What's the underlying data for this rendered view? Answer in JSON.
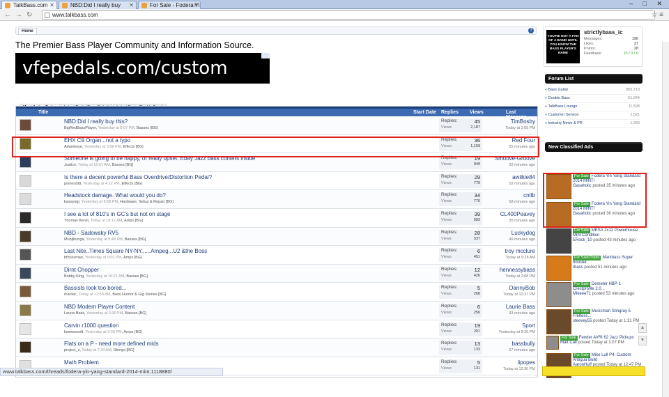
{
  "browser": {
    "tabs": [
      {
        "label": "TalkBass.com",
        "active": true
      },
      {
        "label": "NBD:Did I really buy",
        "active": false
      },
      {
        "label": "For Sale - Fodera Yin",
        "active": false
      }
    ],
    "window_controls": "– □ ✕",
    "url": "www.talkbass.com",
    "status_url": "www.talkbass.com/threads/fodera-yin-yang-standard-2014-mint.1118880/"
  },
  "page": {
    "breadcrumb_home": "Home",
    "help_icon": "?",
    "tagline": "The Premier Bass Player Community and Information Source.",
    "banner_text": "vfepedals.com/custom"
  },
  "list_tabs": [
    "Most Active Today",
    "Latest Posts (Bass Guitar)",
    "Latest Posts (Double Bass)"
  ],
  "table_headers": {
    "title": "Title",
    "start_date": "Start Date",
    "replies": "Replies",
    "views": "Views",
    "last_message": "Last Message"
  },
  "stat_labels": {
    "replies": "Replies:",
    "views": "Views:"
  },
  "threads": [
    {
      "title": "NBD:Did I really buy this?",
      "author": "BigRedBassPlayer",
      "date": "Yesterday at 8:07 PM",
      "forum": "Basses [BG]",
      "replies": "45",
      "views": "2,187",
      "last_user": "TimBosby",
      "last_time": "Today at 2:05 PM"
    },
    {
      "title": "EHX C9 Organ...not a typo",
      "author": "Adamkoye",
      "date": "Yesterday at 3:08 PM",
      "forum": "Effects [BG]",
      "replies": "36",
      "views": "1,159",
      "last_user": "Red Four",
      "last_time": "55 minutes ago"
    },
    {
      "title": "Someone is going to be happy, or really upset. Ebay Jazz bass content inside",
      "author": "Justice",
      "date": "Today at 10:51 AM",
      "forum": "Basses [BG]",
      "replies": "19",
      "views": "949",
      "last_user": "Smoove-Groove",
      "last_time": "32 minutes ago"
    },
    {
      "title": "Is there a decent powerful Bass Overdrive/Distortion Pedal?",
      "author": "jonners98",
      "date": "Yesterday at 4:12 PM",
      "forum": "Effects [BG]",
      "replies": "29",
      "views": "779",
      "last_user": "awilkie84",
      "last_time": "52 minutes ago"
    },
    {
      "title": "Headstock damage. What would you do?",
      "author": "bassyogi",
      "date": "Yesterday at 6:58 PM",
      "forum": "Hardware, Setup & Repair [BG]",
      "replies": "34",
      "views": "770",
      "last_user": "cnltb",
      "last_time": "58 minutes ago"
    },
    {
      "title": "I see a lot of 810's in GC's but not on stage",
      "author": "Thomas Kievit",
      "date": "Today at 10:12 AM",
      "forum": "Amps [BG]",
      "replies": "39",
      "views": "583",
      "last_user": "CL400Peavey",
      "last_time": "35 minutes ago"
    },
    {
      "title": "NBD - Sadowsky RV5",
      "author": "Munjibunga",
      "date": "Yesterday at 5:48 PM",
      "forum": "Basses [BG]",
      "replies": "28",
      "views": "537",
      "last_user": "Luckydog",
      "last_time": "49 minutes ago"
    },
    {
      "title": "Last Nite..Times Square NY-NY......Ampeg...U2 &the Boss",
      "author": "bfbossman",
      "date": "Yesterday at 9:03 PM",
      "forum": "Amps [BG]",
      "replies": "6",
      "views": "451",
      "last_user": "troy mcclure",
      "last_time": "Today at 9:28 AM"
    },
    {
      "title": "Dirnt Chopper",
      "author": "Bobby King",
      "date": "Yesterday at 10:21 AM",
      "forum": "Basses [BG]",
      "replies": "12",
      "views": "426",
      "last_user": "hennessybass",
      "last_time": "Today at 2:08 PM"
    },
    {
      "title": "Bassists look too bored...",
      "author": "mactac",
      "date": "Today at 12:58 AM",
      "forum": "Bass Humor & Gig Stories [BG]",
      "replies": "5",
      "views": "268",
      "last_user": "DannyBob",
      "last_time": "Today at 12:37 PM"
    },
    {
      "title": "NBD Modern Player Content",
      "author": "Laurie Bass",
      "date": "Yesterday at 3:30 PM",
      "forum": "Basses [BG]",
      "replies": "6",
      "views": "256",
      "last_user": "Laurie Bass",
      "last_time": "33 minutes ago"
    },
    {
      "title": "Carvin r1000 question",
      "author": "lowewesoft",
      "date": "Yesterday at 3:03 PM",
      "forum": "Amps [BG]",
      "replies": "19",
      "views": "201",
      "last_user": "5port",
      "last_time": "Yesterday at 8:25 PM"
    },
    {
      "title": "Flats on a P - need more defined mids",
      "author": "project_z",
      "date": "Today at 7:24 AM",
      "forum": "Strings [BG]",
      "replies": "13",
      "views": "133",
      "last_user": "bassbully",
      "last_time": "57 minutes ago"
    },
    {
      "title": "Math Problem",
      "author": "",
      "date": "",
      "forum": "",
      "replies": "5",
      "views": "131",
      "last_user": "iipopes",
      "last_time": "Today at 12:30 PM"
    }
  ],
  "profile": {
    "avatar_text": "YOU'RE NOT A FAN OF A BAND UNTIL YOU KNOW THE BASS PLAYER'S NAME",
    "username": "strictlybass_ic",
    "stats": [
      {
        "label": "Messages:",
        "value": "196"
      },
      {
        "label": "Likes:",
        "value": "37"
      },
      {
        "label": "Points:",
        "value": "28"
      },
      {
        "label": "Feedback:",
        "value": "15 / 0 / 0"
      }
    ]
  },
  "forum_list": {
    "heading": "Forum List",
    "items": [
      {
        "label": "Bass Guitar",
        "count": "865,710"
      },
      {
        "label": "Double Bass",
        "count": "51,844"
      },
      {
        "label": "TalkBass Lounge",
        "count": "11,598"
      },
      {
        "label": "Customer Service",
        "count": "2,521"
      },
      {
        "label": "Industry News & PR",
        "count": "1,293"
      }
    ]
  },
  "classifieds": {
    "heading": "New Classified Ads",
    "posted_word": "posted",
    "items": [
      {
        "badge": "For Sale",
        "title": "Fodera Yin Yang Standard 2014 MINT!",
        "user": "Gasaholic",
        "time": "35 minutes ago"
      },
      {
        "badge": "For Sale",
        "title": "Fodera Yin Yang Standard 2014 MINT!",
        "user": "Gasaholic",
        "time": "36 minutes ago"
      },
      {
        "badge": "For Sale",
        "title": "MESA 2x12 Powerhouse Mint Condition",
        "user": "ERock_10",
        "time": "43 minutes ago"
      },
      {
        "badge": "For Sale/Trade",
        "title": "Markbass Super booster",
        "user": "rbass",
        "time": "51 minutes ago"
      },
      {
        "badge": "For Sale",
        "title": "Demeter HBP-1 Crestprofile 2.0...",
        "user": "Mikeee71",
        "time": "53 minutes ago"
      },
      {
        "badge": "For Sale",
        "title": "Musicman Stingray 5 Fretless...",
        "user": "steevey55",
        "time": "Today at 1:31 PM"
      },
      {
        "badge": "For Sale",
        "title": "Fender AVRI 62 Jazz Pickups",
        "user": "Matt Call",
        "time": "Today at 1:07 PM"
      },
      {
        "badge": "For Sale",
        "title": "Mike Lull P4, Custom Antigua Build",
        "user": "AaronHuff",
        "time": "Today at 12:47 PM"
      }
    ]
  },
  "colors": {
    "accent": "#3d6bb1",
    "highlight": "#e0201a",
    "badge_green": "#3da33a",
    "link": "#1f3d7a"
  }
}
